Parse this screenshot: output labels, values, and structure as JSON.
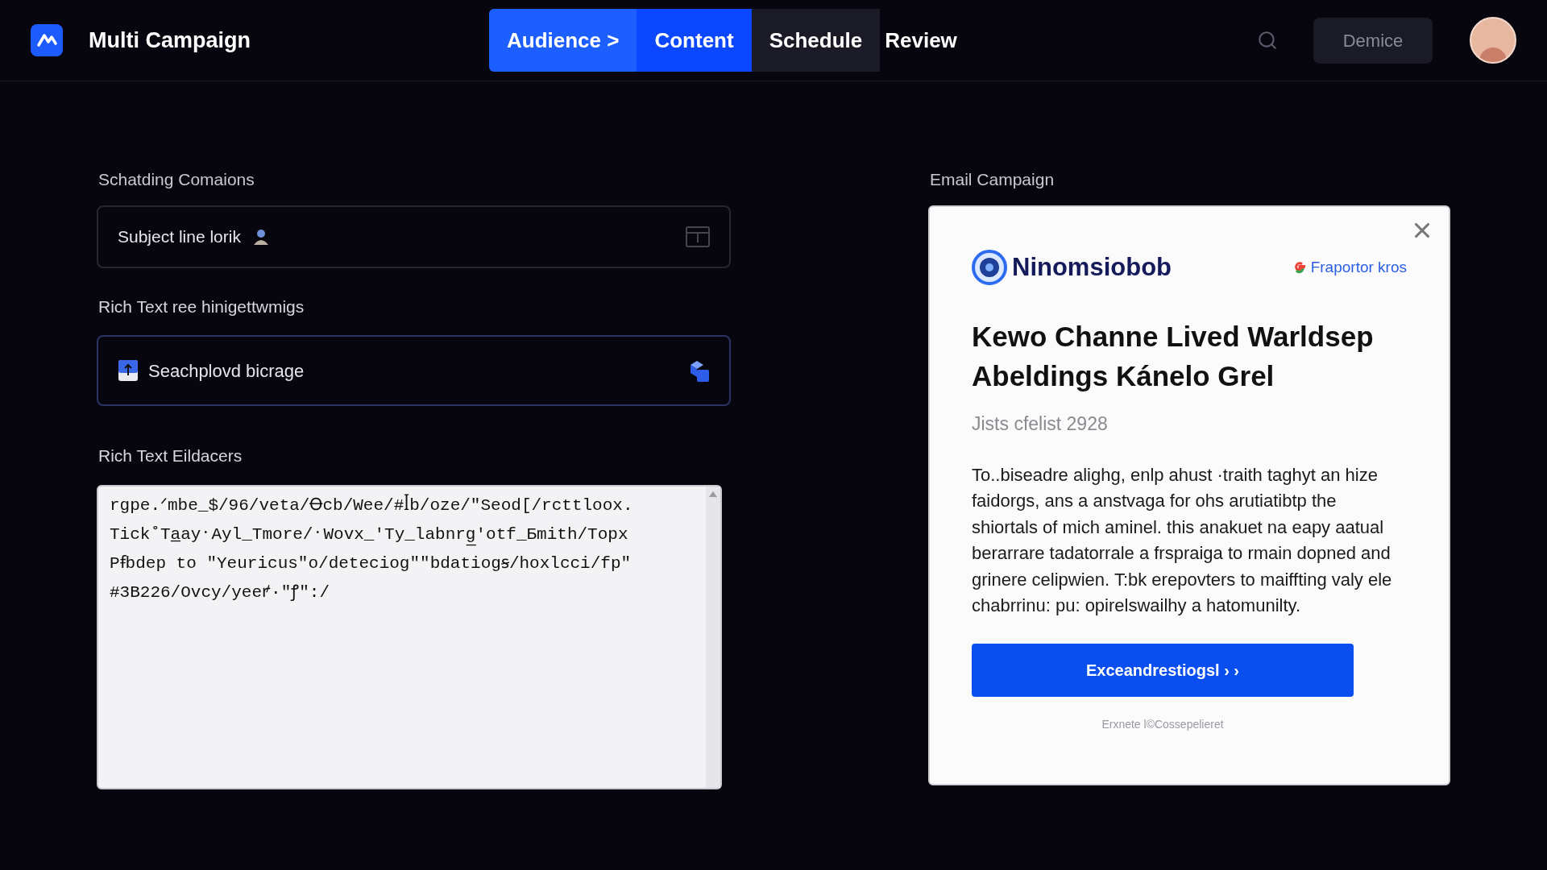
{
  "header": {
    "title": "Multi Campaign",
    "tabs": [
      {
        "label": "Audience >",
        "kind": "done",
        "selected": false
      },
      {
        "label": "Content",
        "kind": "done",
        "selected": true
      },
      {
        "label": "Schedule",
        "kind": "next",
        "selected": false
      },
      {
        "label": "Review",
        "kind": "later",
        "selected": false
      }
    ],
    "account_button": "Demice"
  },
  "form": {
    "section_label": "Schatding Comaions",
    "subject_field": {
      "value": "Subject line lorik"
    },
    "rich_label": "Rich Text ree hinigettwmigs",
    "search_field": {
      "value": "Seachplovd bicrage",
      "focused": true
    },
    "editor_label": "Rich Text Eildacers",
    "editor_lines": [
      "rgpe.ᐟmbe_$/96/veta/Ꝋcb/Wee/#ꟾb/oze/\"Seod[/rcttloox.",
      "Tick˚Ta̲ay᛫Ayl_Tmore/᛫Wovx_ʹTy_labnrg̲ʹotf_Бmith/Topx",
      "Pꞙbdep to \"Yeuricus\"o/deteciog\"\"bdatiogꞩ/hoxlcci/fp\"",
      "#3B226/Ovcy/yeeꝵ·\"ꝭ\":/"
    ]
  },
  "preview": {
    "label": "Email Campaign",
    "brand": "Ninomsiobob",
    "partner": "Fraportor kros",
    "headline": "Kewo Channe Lived  Warldsep Abeldings Kánelo Grel",
    "date": "Jists cfelist 2928",
    "body": "To..biseadre alighg, enlp ahust ·traith taghyt an hize faidorgs, ans a anstvaga for ohs arutiatibtp the shiortals of mich aminel. this anakuet na eapy aatual berarrare tadatorrale a frspraiga to rmain dopned and grinere celipwien. T:bk erepovters to maiffting valy ele chabrrinu: pu: opirelswailhy a hatomunilty.",
    "cta": "Exceandrestiogsl › ›",
    "footer": "Erxnete l©Cossepelieret"
  }
}
